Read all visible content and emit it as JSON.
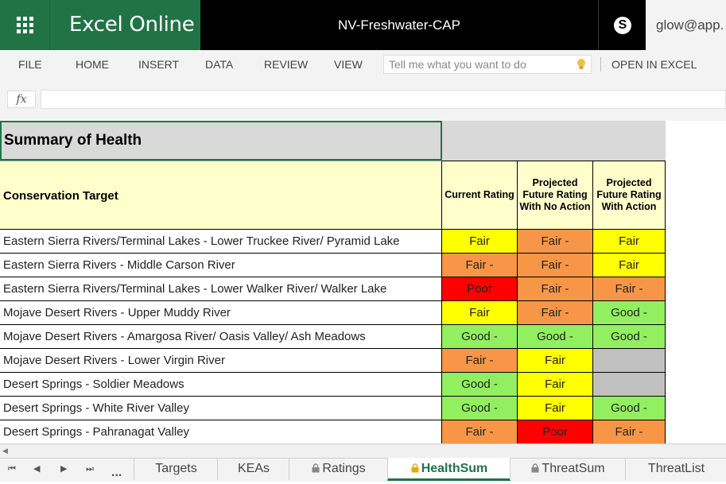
{
  "app": {
    "name": "Excel Online",
    "document": "NV-Freshwater-CAP",
    "user": "glow@app.",
    "accent": "#217346"
  },
  "ribbon": {
    "menu": [
      "FILE",
      "HOME",
      "INSERT",
      "DATA",
      "REVIEW",
      "VIEW"
    ],
    "tell_me_placeholder": "Tell me what you want to do",
    "open_in_excel": "OPEN IN EXCEL"
  },
  "formula_bar": {
    "fx_label": "fx",
    "value": ""
  },
  "sheet": {
    "title": "Summary of Health",
    "headers": {
      "target": "Conservation Target",
      "current": "Current Rating",
      "no_action": "Projected Future Rating With No Action",
      "with_action": "Projected Future Rating With Action"
    },
    "rows": [
      {
        "target": "Eastern Sierra Rivers/Terminal Lakes - Lower Truckee River/ Pyramid Lake",
        "current": "Fair",
        "no_action": "Fair -",
        "with_action": "Fair"
      },
      {
        "target": "Eastern Sierra Rivers - Middle Carson River",
        "current": "Fair -",
        "no_action": "Fair -",
        "with_action": "Fair"
      },
      {
        "target": "Eastern Sierra Rivers/Terminal Lakes - Lower Walker River/ Walker Lake",
        "current": "Poor",
        "no_action": "Fair -",
        "with_action": "Fair -"
      },
      {
        "target": "Mojave Desert Rivers - Upper Muddy River",
        "current": "Fair",
        "no_action": "Fair -",
        "with_action": "Good -"
      },
      {
        "target": "Mojave Desert Rivers - Amargosa River/ Oasis Valley/ Ash Meadows",
        "current": "Good -",
        "no_action": "Good -",
        "with_action": "Good -"
      },
      {
        "target": "Mojave Desert Rivers - Lower Virgin River",
        "current": "Fair -",
        "no_action": "Fair",
        "with_action": ""
      },
      {
        "target": "Desert Springs - Soldier Meadows",
        "current": "Good -",
        "no_action": "Fair",
        "with_action": ""
      },
      {
        "target": "Desert Springs - White River Valley",
        "current": "Good -",
        "no_action": "Fair",
        "with_action": "Good -"
      },
      {
        "target": "Desert Springs - Pahranagat Valley",
        "current": "Fair -",
        "no_action": "Poor",
        "with_action": "Fair -"
      }
    ],
    "rating_colors": {
      "Fair": "#ffff00",
      "Fair -": "#f79646",
      "Poor": "#ff0000",
      "Good -": "#92f060",
      "": "#c0c0c0"
    }
  },
  "sheet_tabs": [
    {
      "label": "Targets",
      "locked": false,
      "active": false
    },
    {
      "label": "KEAs",
      "locked": false,
      "active": false
    },
    {
      "label": "Ratings",
      "locked": true,
      "active": false
    },
    {
      "label": "HealthSum",
      "locked": true,
      "active": true
    },
    {
      "label": "ThreatSum",
      "locked": true,
      "active": false
    },
    {
      "label": "ThreatList",
      "locked": false,
      "active": false
    }
  ],
  "tab_nav": {
    "more": "..."
  }
}
